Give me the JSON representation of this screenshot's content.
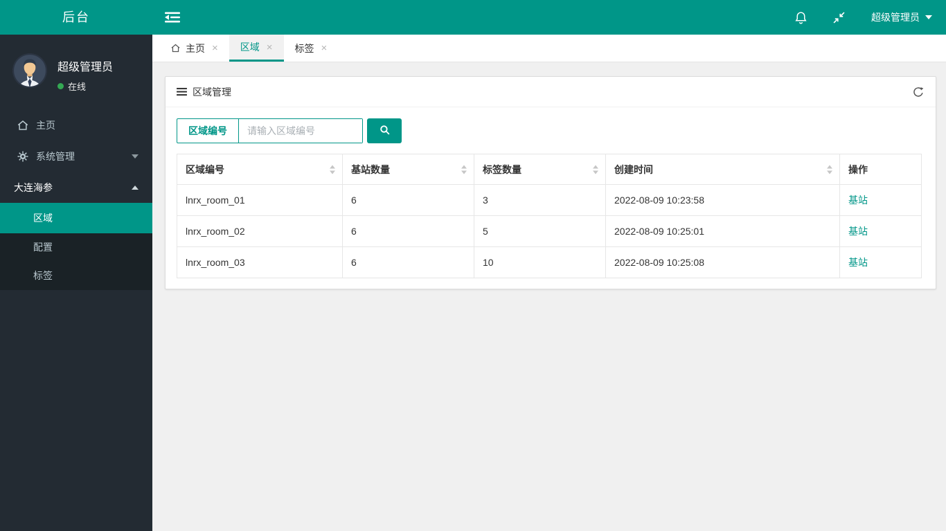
{
  "colors": {
    "primary": "#009688",
    "sidebar_bg": "#232b33",
    "submenu_bg": "#1a2226",
    "content_bg": "#f0f0f0",
    "online_dot": "#34a853",
    "link": "#009688"
  },
  "topbar": {
    "brand": "后台",
    "username": "超级管理员",
    "icons": [
      "fold-icon",
      "bell-icon",
      "compress-icon",
      "caret-down-icon"
    ]
  },
  "sidebar": {
    "user": {
      "name": "超级管理员",
      "status": "在线"
    },
    "menu": {
      "home": {
        "label": "主页",
        "icon": "home-icon"
      },
      "system": {
        "label": "系统管理",
        "icon": "gear-icon",
        "state": "collapsed"
      },
      "group": {
        "label": "大连海参",
        "state": "expanded"
      },
      "sub": {
        "region": {
          "label": "区域",
          "active": true
        },
        "config": {
          "label": "配置",
          "active": false
        },
        "tag": {
          "label": "标签",
          "active": false
        }
      }
    }
  },
  "tabs": {
    "close": "×",
    "items": {
      "home": {
        "label": "主页",
        "icon": "home-icon",
        "active": false
      },
      "region": {
        "label": "区域",
        "active": true
      },
      "tag": {
        "label": "标签",
        "active": false
      }
    }
  },
  "panel": {
    "title": "区域管理",
    "search": {
      "label": "区域编号",
      "placeholder": "请输入区域编号"
    },
    "table": {
      "headers": [
        "区域编号",
        "基站数量",
        "标签数量",
        "创建时间",
        "操作"
      ],
      "rows": [
        {
          "region": "lnrx_room_01",
          "stations": "6",
          "tags": "3",
          "created": "2022-08-09 10:23:58",
          "action": "基站"
        },
        {
          "region": "lnrx_room_02",
          "stations": "6",
          "tags": "5",
          "created": "2022-08-09 10:25:01",
          "action": "基站"
        },
        {
          "region": "lnrx_room_03",
          "stations": "6",
          "tags": "10",
          "created": "2022-08-09 10:25:08",
          "action": "基站"
        }
      ]
    }
  }
}
